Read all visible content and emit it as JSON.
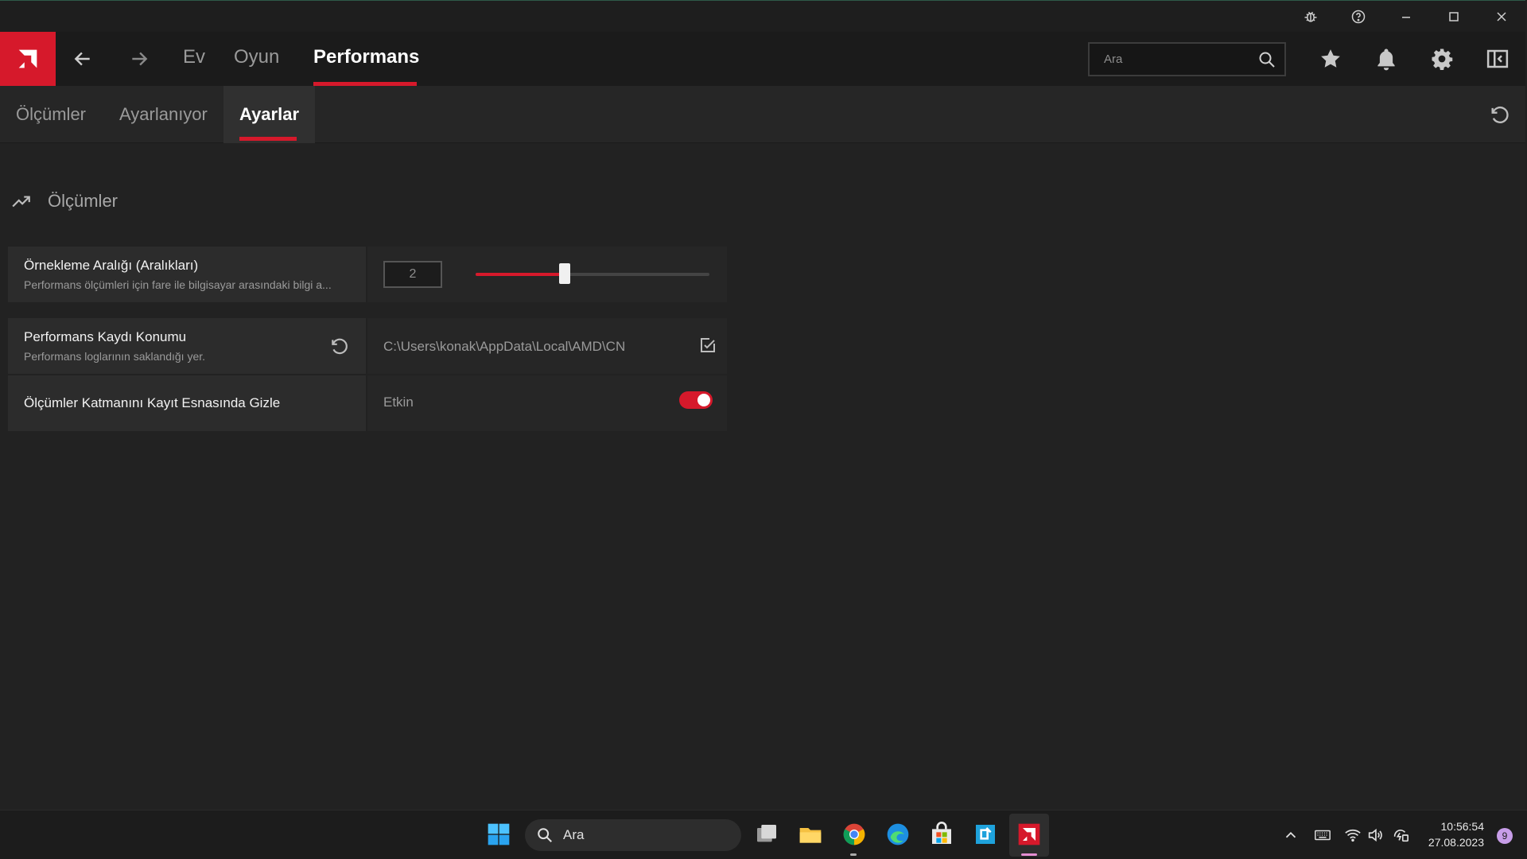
{
  "titlebar": {
    "icons": [
      "bug-icon",
      "help-icon",
      "minimize-icon",
      "maximize-icon",
      "close-icon"
    ]
  },
  "nav": {
    "tabs": [
      {
        "label": "Ev"
      },
      {
        "label": "Oyun"
      },
      {
        "label": "Performans"
      }
    ],
    "active_tab": "Performans",
    "search_placeholder": "Ara",
    "accent": "#d6192b"
  },
  "subnav": {
    "tabs": [
      {
        "label": "Ölçümler"
      },
      {
        "label": "Ayarlanıyor"
      },
      {
        "label": "Ayarlar"
      }
    ],
    "active_tab": "Ayarlar"
  },
  "section": {
    "title": "Ölçümler"
  },
  "settings": {
    "sampling": {
      "title": "Örnekleme Aralığı (Aralıkları)",
      "description": "Performans ölçümleri için fare ile bilgisayar arasındaki bilgi a...",
      "value": "2",
      "slider_fraction": 0.38
    },
    "log_location": {
      "title": "Performans Kaydı Konumu",
      "description": "Performans loglarının saklandığı yer.",
      "path": "C:\\Users\\konak\\AppData\\Local\\AMD\\CN"
    },
    "hide_overlay": {
      "title": "Ölçümler Katmanını Kayıt Esnasında Gizle",
      "state": "Etkin",
      "enabled": true
    }
  },
  "taskbar": {
    "search_label": "Ara",
    "time": "10:56:54",
    "date": "27.08.2023",
    "notification_count": "9"
  }
}
